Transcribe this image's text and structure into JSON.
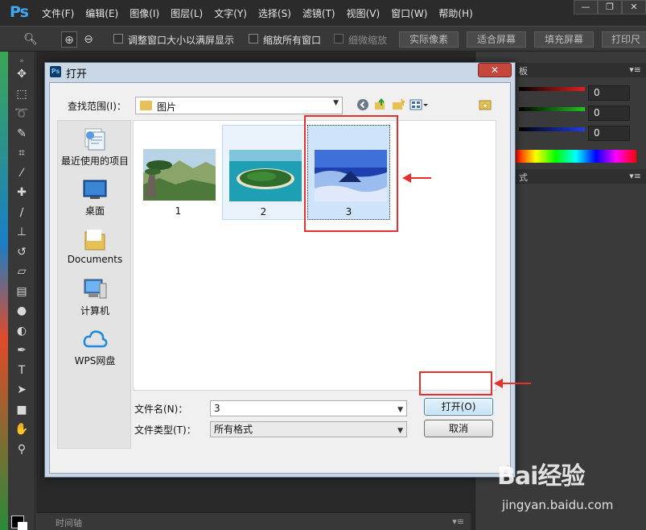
{
  "app": {
    "logo": "Ps"
  },
  "menubar": {
    "items": [
      "文件(F)",
      "编辑(E)",
      "图像(I)",
      "图层(L)",
      "文字(Y)",
      "选择(S)",
      "滤镜(T)",
      "视图(V)",
      "窗口(W)",
      "帮助(H)"
    ]
  },
  "window_controls": {
    "minimize": "—",
    "restore": "❐",
    "close": "✕"
  },
  "options_bar": {
    "resize_windows_label": "调整窗口大小以满屏显示",
    "zoom_all_label": "缩放所有窗口",
    "scrubby_zoom_label": "细微缩放",
    "actual_pixels": "实际像素",
    "fit_screen": "适合屏幕",
    "fill_screen": "填充屏幕",
    "print_size": "打印尺"
  },
  "color_panel": {
    "tab": "板",
    "values": [
      "0",
      "0",
      "0"
    ],
    "channel_colors": [
      "#e41e1e",
      "#1ec61e",
      "#1e3ee4"
    ],
    "second_tab": "式"
  },
  "timeline": {
    "label": "时间轴"
  },
  "dialog": {
    "title": "打开",
    "close": "✕",
    "look_in_label": "查找范围(I)：",
    "look_in_value": "图片",
    "places": [
      "最近使用的项目",
      "桌面",
      "Documents",
      "计算机",
      "WPS网盘"
    ],
    "files": [
      {
        "name": "1",
        "state": "normal"
      },
      {
        "name": "2",
        "state": "hover"
      },
      {
        "name": "3",
        "state": "selected"
      }
    ],
    "filename_label": "文件名(N)：",
    "filename_value": "3",
    "filetype_label": "文件类型(T)：",
    "filetype_value": "所有格式",
    "open_button": "打开(O)",
    "cancel_button": "取消"
  },
  "annotations": {
    "color": "#e5302c"
  },
  "watermark": {
    "brand": "Bai经验",
    "site": "jingyan.baidu.com"
  }
}
